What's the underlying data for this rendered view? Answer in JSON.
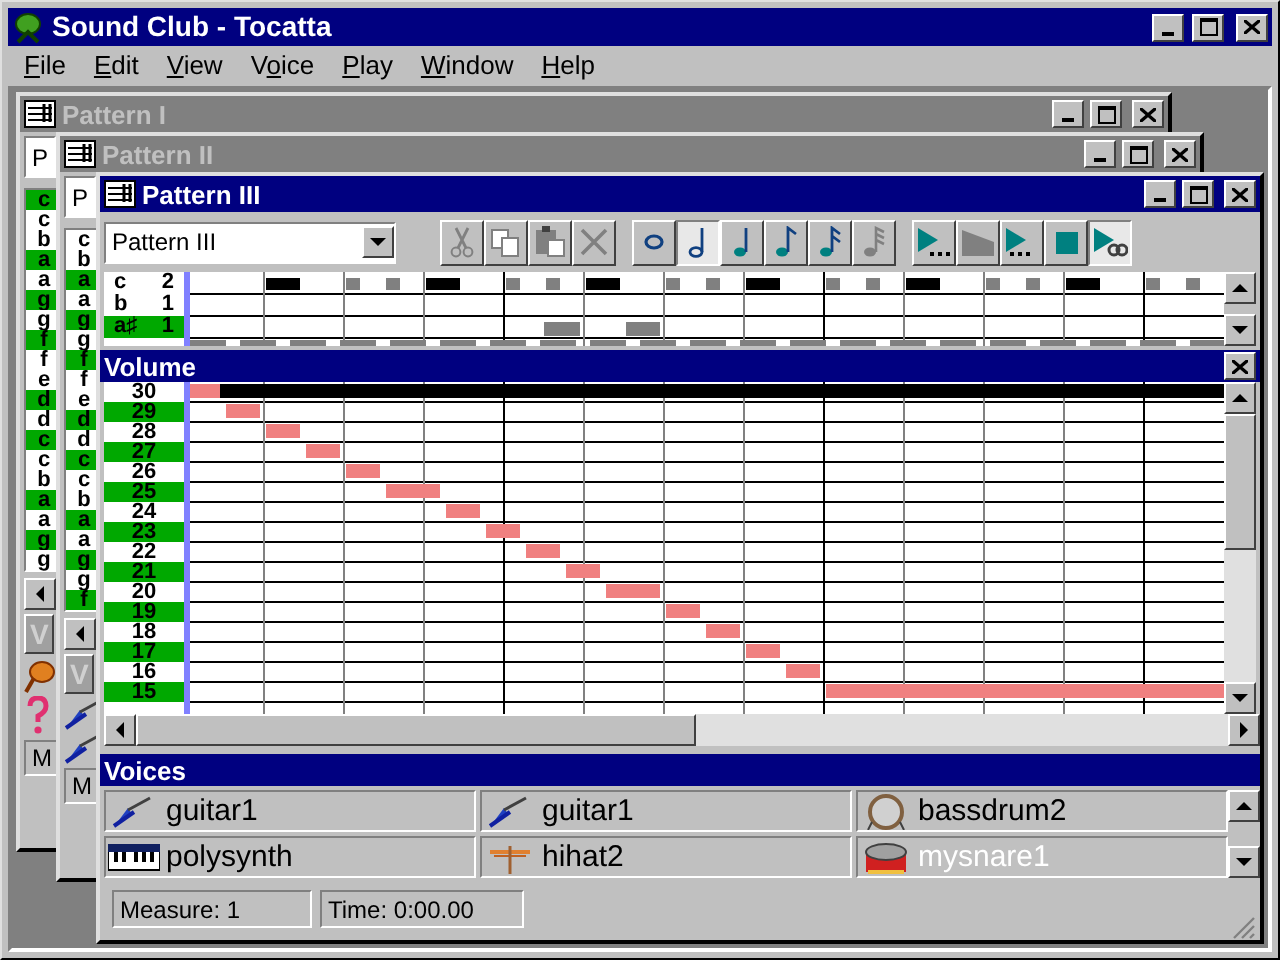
{
  "app": {
    "title": "Sound Club - Tocatta"
  },
  "menu": [
    {
      "key": "F",
      "post": "ile"
    },
    {
      "key": "E",
      "post": "dit"
    },
    {
      "key": "V",
      "post": "iew"
    },
    {
      "pre": "V",
      "key": "o",
      "post": "ice"
    },
    {
      "key": "P",
      "post": "lay"
    },
    {
      "key": "W",
      "post": "indow"
    },
    {
      "key": "H",
      "post": "elp"
    }
  ],
  "background_windows": [
    {
      "title": "Pattern I",
      "active": false,
      "pattern_select": "P",
      "keys": [
        {
          "label": "c",
          "shaded": true
        },
        {
          "label": "c",
          "shaded": false
        },
        {
          "label": "b",
          "shaded": false
        },
        {
          "label": "a",
          "shaded": true
        },
        {
          "label": "a",
          "shaded": false
        },
        {
          "label": "g",
          "shaded": true
        },
        {
          "label": "g",
          "shaded": false
        },
        {
          "label": "f",
          "shaded": true
        },
        {
          "label": "f",
          "shaded": false
        },
        {
          "label": "e",
          "shaded": false
        },
        {
          "label": "d",
          "shaded": true
        },
        {
          "label": "d",
          "shaded": false
        },
        {
          "label": "c",
          "shaded": true
        },
        {
          "label": "c",
          "shaded": false
        },
        {
          "label": "b",
          "shaded": false
        },
        {
          "label": "a",
          "shaded": true
        },
        {
          "label": "a",
          "shaded": false
        },
        {
          "label": "g",
          "shaded": true
        },
        {
          "label": "g",
          "shaded": false
        }
      ],
      "voices_button": "V",
      "voice_icons": [
        {
          "kind": "shaker"
        },
        {
          "kind": "question"
        }
      ],
      "measure_button": "M"
    },
    {
      "title": "Pattern II",
      "active": false,
      "pattern_select": "P",
      "keys": [
        {
          "label": "c",
          "shaded": false
        },
        {
          "label": "b",
          "shaded": false
        },
        {
          "label": "a",
          "shaded": true
        },
        {
          "label": "a",
          "shaded": false
        },
        {
          "label": "g",
          "shaded": true
        },
        {
          "label": "g",
          "shaded": false
        },
        {
          "label": "f",
          "shaded": true
        },
        {
          "label": "f",
          "shaded": false
        },
        {
          "label": "e",
          "shaded": false
        },
        {
          "label": "d",
          "shaded": true
        },
        {
          "label": "d",
          "shaded": false
        },
        {
          "label": "c",
          "shaded": true
        },
        {
          "label": "c",
          "shaded": false
        },
        {
          "label": "b",
          "shaded": false
        },
        {
          "label": "a",
          "shaded": true
        },
        {
          "label": "a",
          "shaded": false
        },
        {
          "label": "g",
          "shaded": true
        },
        {
          "label": "g",
          "shaded": false
        },
        {
          "label": "f",
          "shaded": true
        }
      ],
      "voices_button": "V",
      "voice_icons": [
        {
          "kind": "guitar"
        },
        {
          "kind": "guitar"
        }
      ],
      "measure_button": "M"
    }
  ],
  "pattern_window": {
    "title": "Pattern III",
    "active": true,
    "pattern_select": "Pattern III",
    "tools": [
      {
        "kind": "cut",
        "pressed": false,
        "disabled": true
      },
      {
        "kind": "copy",
        "pressed": false,
        "disabled": true
      },
      {
        "kind": "paste",
        "pressed": false,
        "disabled": true
      },
      {
        "kind": "delete",
        "pressed": false,
        "disabled": true
      },
      {
        "kind": "whole",
        "pressed": false,
        "disabled": false
      },
      {
        "kind": "half",
        "pressed": true,
        "disabled": false
      },
      {
        "kind": "quarter",
        "pressed": false,
        "disabled": false
      },
      {
        "kind": "eighth",
        "pressed": false,
        "disabled": false
      },
      {
        "kind": "sixteenth",
        "pressed": false,
        "disabled": false
      },
      {
        "kind": "thirtysecond",
        "pressed": false,
        "disabled": true
      },
      {
        "kind": "play_from",
        "pressed": false,
        "disabled": false
      },
      {
        "kind": "ramp",
        "pressed": false,
        "disabled": true
      },
      {
        "kind": "play",
        "pressed": false,
        "disabled": false
      },
      {
        "kind": "stop",
        "pressed": false,
        "disabled": false
      },
      {
        "kind": "loop",
        "pressed": true,
        "disabled": false
      }
    ],
    "note_rows": [
      {
        "note": "c",
        "octave": "2",
        "shaded": false
      },
      {
        "note": "b",
        "octave": "1",
        "shaded": false
      },
      {
        "note": "a♯",
        "octave": "1",
        "shaded": true
      }
    ],
    "volume": {
      "title": "Volume",
      "rows": [
        {
          "label": "30",
          "shaded": false
        },
        {
          "label": "29",
          "shaded": true
        },
        {
          "label": "28",
          "shaded": false
        },
        {
          "label": "27",
          "shaded": true
        },
        {
          "label": "26",
          "shaded": false
        },
        {
          "label": "25",
          "shaded": true
        },
        {
          "label": "24",
          "shaded": false
        },
        {
          "label": "23",
          "shaded": true
        },
        {
          "label": "22",
          "shaded": false
        },
        {
          "label": "21",
          "shaded": true
        },
        {
          "label": "20",
          "shaded": false
        },
        {
          "label": "19",
          "shaded": true
        },
        {
          "label": "18",
          "shaded": false
        },
        {
          "label": "17",
          "shaded": true
        },
        {
          "label": "16",
          "shaded": false
        },
        {
          "label": "15",
          "shaded": true
        }
      ]
    },
    "voices": {
      "title": "Voices",
      "items": [
        {
          "name": "guitar1",
          "kind": "guitar",
          "selected": false
        },
        {
          "name": "guitar1",
          "kind": "guitar",
          "selected": false
        },
        {
          "name": "bassdrum2",
          "kind": "bassdrum",
          "selected": false
        },
        {
          "name": "polysynth",
          "kind": "synth",
          "selected": false
        },
        {
          "name": "hihat2",
          "kind": "hihat",
          "selected": false
        },
        {
          "name": "mysnare1",
          "kind": "snare",
          "selected": true
        }
      ]
    },
    "status_bar": {
      "measure": "Measure: 1",
      "time": "Time: 0:00.00"
    }
  }
}
